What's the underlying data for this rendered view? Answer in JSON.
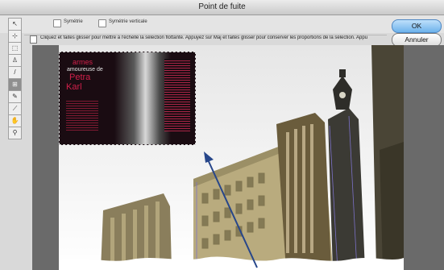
{
  "dialog": {
    "title": "Point de fuite"
  },
  "options": {
    "symmetry": "Symétrie",
    "vertical_symmetry": "Symétrie verticale"
  },
  "hint": "Cliquez et faites glisser pour mettre à l'échelle la sélection flottante. Appuyez sur Maj et faites glisser pour conserver les proportions de la sélection. Appu",
  "buttons": {
    "ok": "OK",
    "cancel": "Annuler"
  },
  "poster": {
    "line1": "armes",
    "line2": "amoureuse de",
    "line3": "Petra",
    "line4": "Karl"
  },
  "tools": [
    {
      "icon": "edit-plane-icon",
      "glyph": "↖"
    },
    {
      "icon": "create-plane-icon",
      "glyph": "⊹"
    },
    {
      "icon": "marquee-icon",
      "glyph": "⬚"
    },
    {
      "icon": "stamp-icon",
      "glyph": "♙"
    },
    {
      "icon": "brush-icon",
      "glyph": "/"
    },
    {
      "icon": "transform-icon",
      "glyph": "⊞"
    },
    {
      "icon": "eyedropper-icon",
      "glyph": "✎"
    },
    {
      "icon": "measure-icon",
      "glyph": "⟋"
    },
    {
      "icon": "hand-icon",
      "glyph": "✋"
    },
    {
      "icon": "zoom-icon",
      "glyph": "⚲"
    }
  ],
  "colors": {
    "ok_button": "#6db2ec",
    "poster_red": "#d0204a",
    "arrow": "#27468a"
  }
}
